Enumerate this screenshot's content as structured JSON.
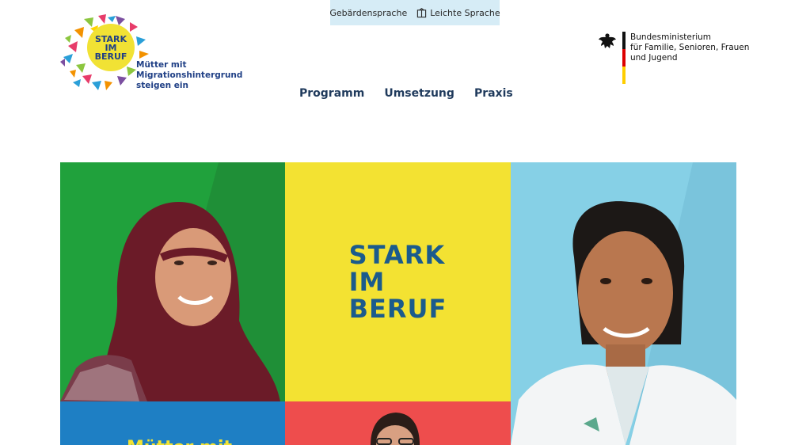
{
  "topbar": {
    "sign_language": "Gebärdensprache",
    "easy_language": "Leichte Sprache"
  },
  "logo": {
    "line1": "STARK",
    "line2": "IM",
    "line3": "BERUF",
    "tag1": "Mütter mit",
    "tag2": "Migrationshintergrund",
    "tag3": "steigen ein"
  },
  "ministry": {
    "line1": "Bundesministerium",
    "line2": "für Familie, Senioren, Frauen",
    "line3": "und Jugend"
  },
  "nav": {
    "items": [
      {
        "label": "Programm"
      },
      {
        "label": "Umsetzung"
      },
      {
        "label": "Praxis"
      }
    ]
  },
  "hero": {
    "title1": "STARK",
    "title2": "IM",
    "title3": "BERUF",
    "subheading": "Mütter mit"
  },
  "colors": {
    "green": "#20a13c",
    "yellow": "#f3e232",
    "lightblue": "#86d0e6",
    "blue": "#1e7fc4",
    "red": "#ee4d4d",
    "navy": "#1f3a5c"
  }
}
